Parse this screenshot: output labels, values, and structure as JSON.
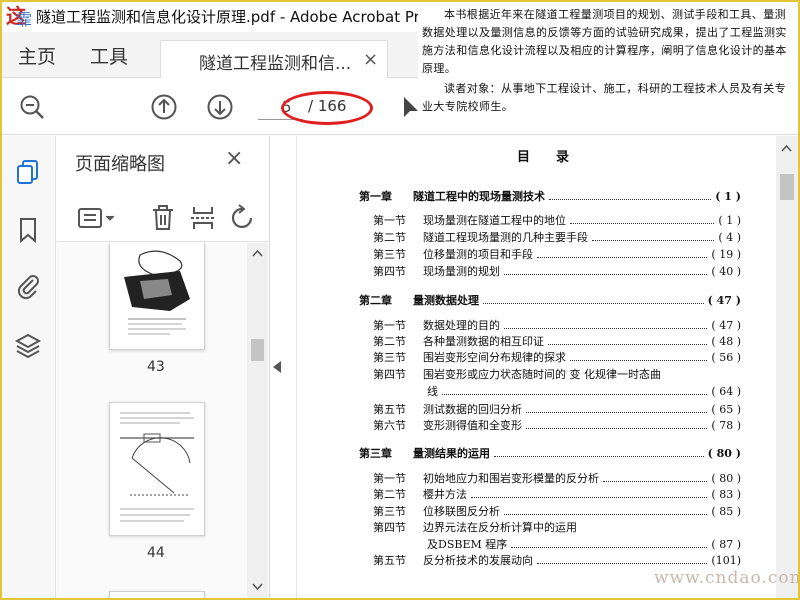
{
  "window": {
    "title": "隧道工程监测和信息化设计原理.pdf - Adobe Acrobat Pro DC",
    "logo_text": "这",
    "logo_sub": "霏"
  },
  "tabs": {
    "home": "主页",
    "tools": "工具",
    "document": "隧道工程监测和信...",
    "close": "×"
  },
  "toolbar": {
    "current_page": "5",
    "total_pages": "/ 166",
    "accent_color": "#e02020"
  },
  "overlay_text": {
    "para1": "本书根据近年来在隧道工程量测项目的规划、测试手段和工具、量测数据处理以及量测信息的反馈等方面的试验研究成果，提出了工程监测实施方法和信息化设计流程以及相应的计算程序，阐明了信息化设计的基本原理。",
    "para2": "读者对象：从事地下工程设计、施工，科研的工程技术人员及有关专业大专院校师生。"
  },
  "thumbnails": {
    "title": "页面缩略图",
    "close": "×",
    "pages": [
      {
        "label": "43"
      },
      {
        "label": "44"
      }
    ]
  },
  "toc": {
    "title": "目录",
    "entries": [
      {
        "label": "第一章",
        "text": "隧道工程中的现场量测技术",
        "page": "( 1 )",
        "chapter": true
      },
      {
        "label": "第一节",
        "text": "现场量测在隧道工程中的地位",
        "page": "( 1 )",
        "chapter": false
      },
      {
        "label": "第二节",
        "text": "隧道工程现场量测的几种主要手段",
        "page": "( 4 )",
        "chapter": false
      },
      {
        "label": "第三节",
        "text": "位移量测的项目和手段",
        "page": "( 19 )",
        "chapter": false
      },
      {
        "label": "第四节",
        "text": "现场量测的规划",
        "page": "( 40 )",
        "chapter": false
      },
      {
        "label": "第二章",
        "text": "量测数据处理",
        "page": "( 47 )",
        "chapter": true
      },
      {
        "label": "第一节",
        "text": "数据处理的目的",
        "page": "( 47 )",
        "chapter": false
      },
      {
        "label": "第二节",
        "text": "各种量测数据的相互印证",
        "page": "( 48 )",
        "chapter": false
      },
      {
        "label": "第三节",
        "text": "围岩变形空间分布规律的探求",
        "page": "( 56 )",
        "chapter": false
      },
      {
        "label": "第四节",
        "text": "围岩变形或应力状态随时间的 变 化规律一时态曲",
        "page": "",
        "chapter": false
      },
      {
        "label": "",
        "text": "线",
        "page": "( 64 )",
        "chapter": false
      },
      {
        "label": "第五节",
        "text": "测试数据的回归分析",
        "page": "( 65 )",
        "chapter": false
      },
      {
        "label": "第六节",
        "text": "变形测得值和全变形",
        "page": "( 78 )",
        "chapter": false
      },
      {
        "label": "第三章",
        "text": "量测结果的运用",
        "page": "( 80 )",
        "chapter": true
      },
      {
        "label": "第一节",
        "text": "初始地应力和围岩变形模量的反分析",
        "page": "( 80 )",
        "chapter": false
      },
      {
        "label": "第二节",
        "text": "樱井方法",
        "page": "( 83 )",
        "chapter": false
      },
      {
        "label": "第三节",
        "text": "位移联图反分析",
        "page": "( 85 )",
        "chapter": false
      },
      {
        "label": "第四节",
        "text": "边界元法在反分析计算中的运用",
        "page": "",
        "chapter": false
      },
      {
        "label": "",
        "text": "及DSBEM 程序",
        "page": "( 87 )",
        "chapter": false
      },
      {
        "label": "第五节",
        "text": "反分析技术的发展动向",
        "page": "(101)",
        "chapter": false
      }
    ]
  },
  "watermark": "www.cndao.com"
}
